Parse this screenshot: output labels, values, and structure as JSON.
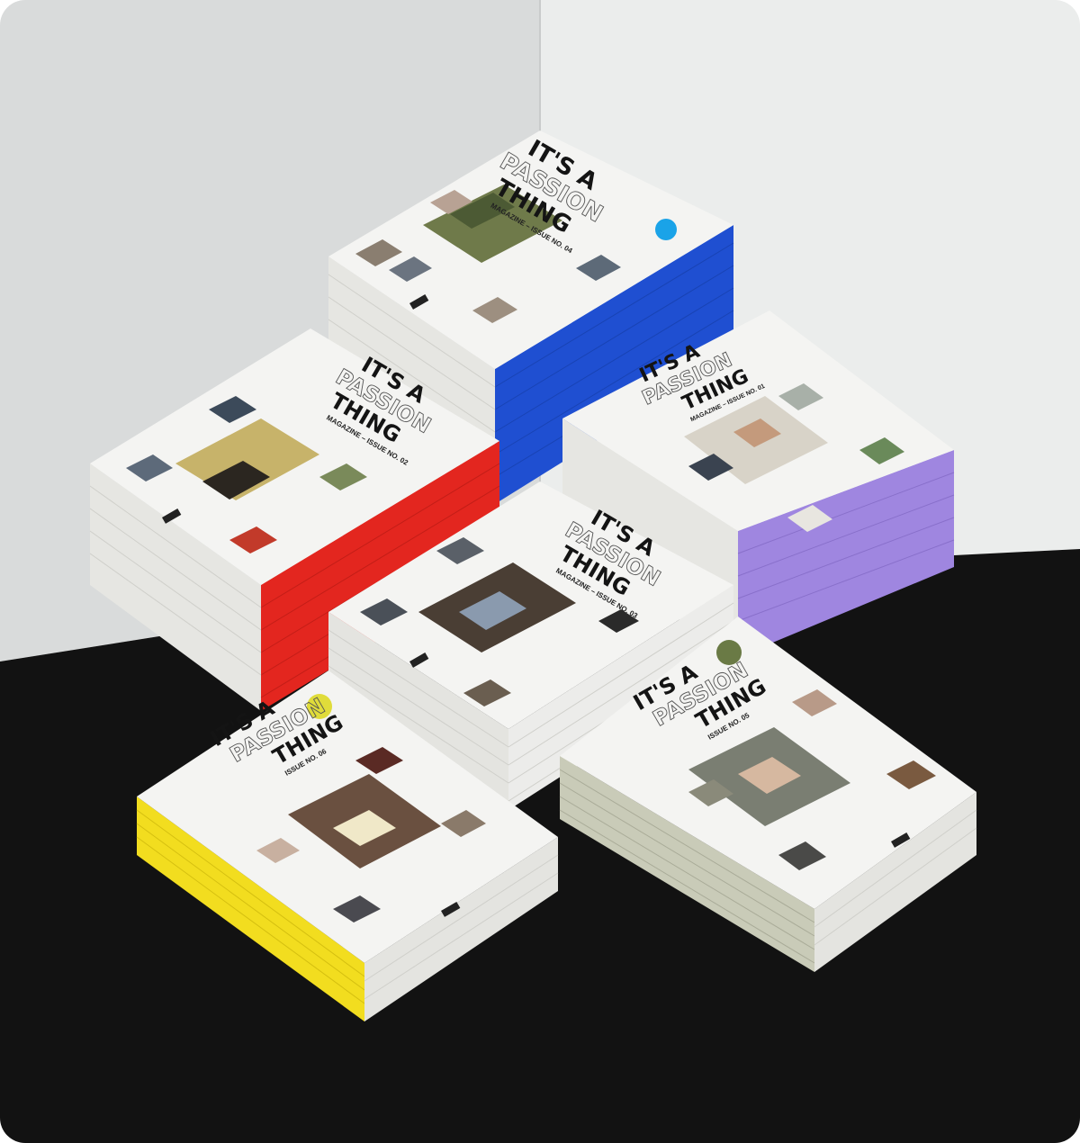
{
  "scene": {
    "description_free": true,
    "colors": {
      "wall_left": "#d9dbdb",
      "wall_right": "#ebedec",
      "floor": "#121212",
      "cover": "#f4f4f2",
      "page_edge": "#e4e4e0"
    }
  },
  "magazines": [
    {
      "id": "issue-04",
      "title_line1": "IT'S A",
      "title_line2": "PASSION",
      "title_line3": "THING",
      "issue_label": "MAGAZINE – ISSUE NO. 04",
      "spine_color": "#1f4fd1",
      "accent_dot": "#1aa3e8"
    },
    {
      "id": "issue-02",
      "title_line1": "IT'S A",
      "title_line2": "PASSION",
      "title_line3": "THING",
      "issue_label": "MAGAZINE – ISSUE NO. 02",
      "spine_color": "#e3261f",
      "accent_dot": ""
    },
    {
      "id": "issue-01",
      "title_line1": "IT'S A",
      "title_line2": "PASSION",
      "title_line3": "THING",
      "issue_label": "MAGAZINE – ISSUE NO. 01",
      "spine_color": "#9f86e0",
      "accent_dot": ""
    },
    {
      "id": "issue-03",
      "title_line1": "IT'S A",
      "title_line2": "PASSION",
      "title_line3": "THING",
      "issue_label": "MAGAZINE – ISSUE NO. 03",
      "spine_color": "#ececea",
      "accent_dot": ""
    },
    {
      "id": "issue-06",
      "title_line1": "IT'S A",
      "title_line2": "PASSION",
      "title_line3": "THING",
      "issue_label": "ISSUE NO. 06",
      "spine_color": "#f2dd1f",
      "accent_dot": "#e0dc3a"
    },
    {
      "id": "issue-05",
      "title_line1": "IT'S A",
      "title_line2": "PASSION",
      "title_line3": "THING",
      "issue_label": "ISSUE NO. 05",
      "spine_color": "#c9cbb8",
      "accent_dot": "#6a7a45"
    }
  ]
}
